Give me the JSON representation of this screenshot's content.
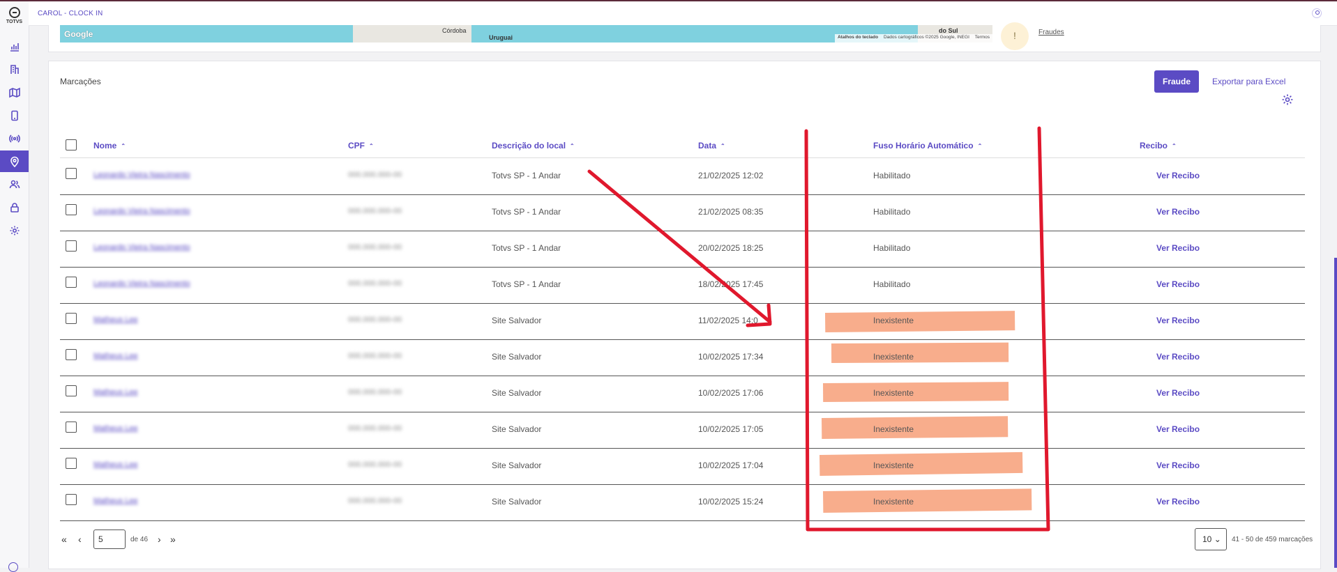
{
  "header": {
    "app_title": "CAROL - CLOCK IN"
  },
  "sidebar": {
    "logo_text": "TOTVS",
    "items": [
      {
        "icon": "bar-chart-icon"
      },
      {
        "icon": "building-icon"
      },
      {
        "icon": "map-icon"
      },
      {
        "icon": "phone-icon"
      },
      {
        "icon": "broadcast-icon"
      },
      {
        "icon": "location-pin-icon",
        "active": true
      },
      {
        "icon": "users-icon"
      },
      {
        "icon": "lock-icon"
      },
      {
        "icon": "gear-icon"
      }
    ]
  },
  "map": {
    "google_label": "Google",
    "cities": [
      "Córdoba",
      "Uruguai",
      "do Sul"
    ],
    "attribution": [
      "Atalhos do teclado",
      "Dados cartográficos ©2025 Google, INEGI",
      "Termos"
    ]
  },
  "fraud_summary": {
    "link_label": "Fraudes"
  },
  "marcacoes": {
    "title": "Marcações",
    "fraude_button": "Fraude",
    "export_button": "Exportar para Excel",
    "columns": [
      "Nome",
      "CPF",
      "Descrição do local",
      "Data",
      "Fuso Horário Automático",
      "Recibo"
    ],
    "rows": [
      {
        "nome": "Leonardo Vieira Nascimento",
        "cpf": "000.000.000-00",
        "local": "Totvs SP - 1 Andar",
        "data": "21/02/2025 12:02",
        "fuso": "Habilitado",
        "recibo": "Ver Recibo"
      },
      {
        "nome": "Leonardo Vieira Nascimento",
        "cpf": "000.000.000-00",
        "local": "Totvs SP - 1 Andar",
        "data": "21/02/2025 08:35",
        "fuso": "Habilitado",
        "recibo": "Ver Recibo"
      },
      {
        "nome": "Leonardo Vieira Nascimento",
        "cpf": "000.000.000-00",
        "local": "Totvs SP - 1 Andar",
        "data": "20/02/2025 18:25",
        "fuso": "Habilitado",
        "recibo": "Ver Recibo"
      },
      {
        "nome": "Leonardo Vieira Nascimento",
        "cpf": "000.000.000-00",
        "local": "Totvs SP - 1 Andar",
        "data": "18/02/2025 17:45",
        "fuso": "Habilitado",
        "recibo": "Ver Recibo"
      },
      {
        "nome": "Matheus Lee",
        "cpf": "000.000.000-00",
        "local": "Site Salvador",
        "data": "11/02/2025 14:0",
        "fuso": "Inexistente",
        "recibo": "Ver Recibo"
      },
      {
        "nome": "Matheus Lee",
        "cpf": "000.000.000-00",
        "local": "Site Salvador",
        "data": "10/02/2025 17:34",
        "fuso": "Inexistente",
        "recibo": "Ver Recibo"
      },
      {
        "nome": "Matheus Lee",
        "cpf": "000.000.000-00",
        "local": "Site Salvador",
        "data": "10/02/2025 17:06",
        "fuso": "Inexistente",
        "recibo": "Ver Recibo"
      },
      {
        "nome": "Matheus Lee",
        "cpf": "000.000.000-00",
        "local": "Site Salvador",
        "data": "10/02/2025 17:05",
        "fuso": "Inexistente",
        "recibo": "Ver Recibo"
      },
      {
        "nome": "Matheus Lee",
        "cpf": "000.000.000-00",
        "local": "Site Salvador",
        "data": "10/02/2025 17:04",
        "fuso": "Inexistente",
        "recibo": "Ver Recibo"
      },
      {
        "nome": "Matheus Lee",
        "cpf": "000.000.000-00",
        "local": "Site Salvador",
        "data": "10/02/2025 15:24",
        "fuso": "Inexistente",
        "recibo": "Ver Recibo"
      }
    ]
  },
  "pagination": {
    "current_page": "5",
    "of_label": "de 46",
    "page_size": "10",
    "range_label": "41 - 50 de 459 marcações"
  },
  "colors": {
    "accent": "#5b4bc4",
    "annotation_red": "#e0182d",
    "highlight_orange": "#f7a47f"
  }
}
